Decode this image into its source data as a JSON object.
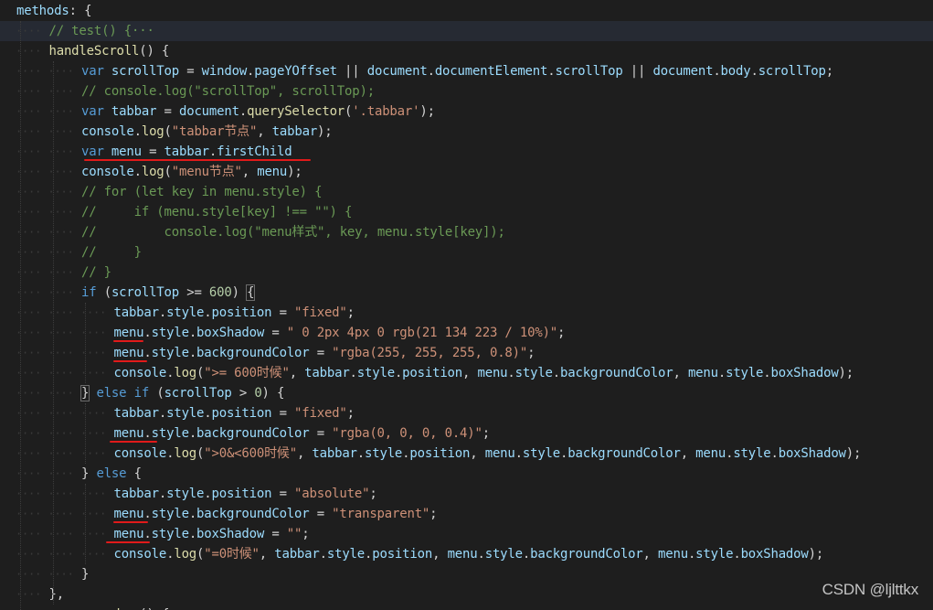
{
  "editor": {
    "language": "javascript",
    "theme_colors": {
      "keyword": "#569cd6",
      "variable": "#9cdcfe",
      "function": "#dcdcaa",
      "string": "#ce9178",
      "number": "#b5cea8",
      "comment": "#6a9955",
      "background": "#1e1e1e"
    },
    "lines": [
      {
        "indent": 0,
        "tokens": [
          [
            "v",
            "methods"
          ],
          [
            "p",
            ": {"
          ]
        ]
      },
      {
        "indent": 1,
        "active": true,
        "tokens": [
          [
            "c",
            "// test() {···"
          ]
        ]
      },
      {
        "indent": 1,
        "tokens": [
          [
            "f",
            "handleScroll"
          ],
          [
            "p",
            "() {"
          ]
        ]
      },
      {
        "indent": 2,
        "tokens": [
          [
            "k",
            "var"
          ],
          [
            "p",
            " "
          ],
          [
            "v",
            "scrollTop"
          ],
          [
            "p",
            " = "
          ],
          [
            "v",
            "window"
          ],
          [
            "p",
            "."
          ],
          [
            "v",
            "pageYOffset"
          ],
          [
            "p",
            " || "
          ],
          [
            "v",
            "document"
          ],
          [
            "p",
            "."
          ],
          [
            "v",
            "documentElement"
          ],
          [
            "p",
            "."
          ],
          [
            "v",
            "scrollTop"
          ],
          [
            "p",
            " || "
          ],
          [
            "v",
            "document"
          ],
          [
            "p",
            "."
          ],
          [
            "v",
            "body"
          ],
          [
            "p",
            "."
          ],
          [
            "v",
            "scrollTop"
          ],
          [
            "p",
            ";"
          ]
        ]
      },
      {
        "indent": 2,
        "tokens": [
          [
            "c",
            "// console.log(\"scrollTop\", scrollTop);"
          ]
        ]
      },
      {
        "indent": 2,
        "tokens": [
          [
            "k",
            "var"
          ],
          [
            "p",
            " "
          ],
          [
            "v",
            "tabbar"
          ],
          [
            "p",
            " = "
          ],
          [
            "v",
            "document"
          ],
          [
            "p",
            "."
          ],
          [
            "f",
            "querySelector"
          ],
          [
            "p",
            "("
          ],
          [
            "s",
            "'.tabbar'"
          ],
          [
            "p",
            ");"
          ]
        ]
      },
      {
        "indent": 2,
        "tokens": [
          [
            "v",
            "console"
          ],
          [
            "p",
            "."
          ],
          [
            "f",
            "log"
          ],
          [
            "p",
            "("
          ],
          [
            "s",
            "\"tabbar节点\""
          ],
          [
            "p",
            ", "
          ],
          [
            "v",
            "tabbar"
          ],
          [
            "p",
            ");"
          ]
        ]
      },
      {
        "indent": 2,
        "tokens": [
          [
            "k",
            "var"
          ],
          [
            "p",
            " "
          ],
          [
            "v",
            "menu"
          ],
          [
            "p",
            " = "
          ],
          [
            "v",
            "tabbar"
          ],
          [
            "p",
            "."
          ],
          [
            "v",
            "firstChild"
          ]
        ]
      },
      {
        "indent": 2,
        "tokens": [
          [
            "v",
            "console"
          ],
          [
            "p",
            "."
          ],
          [
            "f",
            "log"
          ],
          [
            "p",
            "("
          ],
          [
            "s",
            "\"menu节点\""
          ],
          [
            "p",
            ", "
          ],
          [
            "v",
            "menu"
          ],
          [
            "p",
            ");"
          ]
        ]
      },
      {
        "indent": 2,
        "tokens": [
          [
            "c",
            "// for (let key in menu.style) {"
          ]
        ]
      },
      {
        "indent": 2,
        "tokens": [
          [
            "c",
            "//     if (menu.style[key] !== \"\") {"
          ]
        ]
      },
      {
        "indent": 2,
        "tokens": [
          [
            "c",
            "//         console.log(\"menu样式\", key, menu.style[key]);"
          ]
        ]
      },
      {
        "indent": 2,
        "tokens": [
          [
            "c",
            "//     }"
          ]
        ]
      },
      {
        "indent": 2,
        "tokens": [
          [
            "c",
            "// }"
          ]
        ]
      },
      {
        "indent": 2,
        "tokens": [
          [
            "k",
            "if"
          ],
          [
            "p",
            " ("
          ],
          [
            "v",
            "scrollTop"
          ],
          [
            "p",
            " >= "
          ],
          [
            "n",
            "600"
          ],
          [
            "p",
            ") "
          ],
          [
            "sel",
            "{"
          ]
        ]
      },
      {
        "indent": 3,
        "tokens": [
          [
            "v",
            "tabbar"
          ],
          [
            "p",
            "."
          ],
          [
            "v",
            "style"
          ],
          [
            "p",
            "."
          ],
          [
            "v",
            "position"
          ],
          [
            "p",
            " = "
          ],
          [
            "s",
            "\"fixed\""
          ],
          [
            "p",
            ";"
          ]
        ]
      },
      {
        "indent": 3,
        "tokens": [
          [
            "v",
            "menu"
          ],
          [
            "p",
            "."
          ],
          [
            "v",
            "style"
          ],
          [
            "p",
            "."
          ],
          [
            "v",
            "boxShadow"
          ],
          [
            "p",
            " = "
          ],
          [
            "s",
            "\" 0 2px 4px 0 rgb(21 134 223 / 10%)\""
          ],
          [
            "p",
            ";"
          ]
        ]
      },
      {
        "indent": 3,
        "tokens": [
          [
            "v",
            "menu"
          ],
          [
            "p",
            "."
          ],
          [
            "v",
            "style"
          ],
          [
            "p",
            "."
          ],
          [
            "v",
            "backgroundColor"
          ],
          [
            "p",
            " = "
          ],
          [
            "s",
            "\"rgba(255, 255, 255, 0.8)\""
          ],
          [
            "p",
            ";"
          ]
        ]
      },
      {
        "indent": 3,
        "tokens": [
          [
            "v",
            "console"
          ],
          [
            "p",
            "."
          ],
          [
            "f",
            "log"
          ],
          [
            "p",
            "("
          ],
          [
            "s",
            "\">= 600时候\""
          ],
          [
            "p",
            ", "
          ],
          [
            "v",
            "tabbar"
          ],
          [
            "p",
            "."
          ],
          [
            "v",
            "style"
          ],
          [
            "p",
            "."
          ],
          [
            "v",
            "position"
          ],
          [
            "p",
            ", "
          ],
          [
            "v",
            "menu"
          ],
          [
            "p",
            "."
          ],
          [
            "v",
            "style"
          ],
          [
            "p",
            "."
          ],
          [
            "v",
            "backgroundColor"
          ],
          [
            "p",
            ", "
          ],
          [
            "v",
            "menu"
          ],
          [
            "p",
            "."
          ],
          [
            "v",
            "style"
          ],
          [
            "p",
            "."
          ],
          [
            "v",
            "boxShadow"
          ],
          [
            "p",
            ");"
          ]
        ]
      },
      {
        "indent": 2,
        "tokens": [
          [
            "sel",
            "}"
          ],
          [
            "p",
            " "
          ],
          [
            "k",
            "else"
          ],
          [
            "p",
            " "
          ],
          [
            "k",
            "if"
          ],
          [
            "p",
            " ("
          ],
          [
            "v",
            "scrollTop"
          ],
          [
            "p",
            " > "
          ],
          [
            "n",
            "0"
          ],
          [
            "p",
            ") {"
          ]
        ]
      },
      {
        "indent": 3,
        "tokens": [
          [
            "v",
            "tabbar"
          ],
          [
            "p",
            "."
          ],
          [
            "v",
            "style"
          ],
          [
            "p",
            "."
          ],
          [
            "v",
            "position"
          ],
          [
            "p",
            " = "
          ],
          [
            "s",
            "\"fixed\""
          ],
          [
            "p",
            ";"
          ]
        ]
      },
      {
        "indent": 3,
        "tokens": [
          [
            "v",
            "menu"
          ],
          [
            "p",
            "."
          ],
          [
            "v",
            "style"
          ],
          [
            "p",
            "."
          ],
          [
            "v",
            "backgroundColor"
          ],
          [
            "p",
            " = "
          ],
          [
            "s",
            "\"rgba(0, 0, 0, 0.4)\""
          ],
          [
            "p",
            ";"
          ]
        ]
      },
      {
        "indent": 3,
        "tokens": [
          [
            "v",
            "console"
          ],
          [
            "p",
            "."
          ],
          [
            "f",
            "log"
          ],
          [
            "p",
            "("
          ],
          [
            "s",
            "\">0&<600时候\""
          ],
          [
            "p",
            ", "
          ],
          [
            "v",
            "tabbar"
          ],
          [
            "p",
            "."
          ],
          [
            "v",
            "style"
          ],
          [
            "p",
            "."
          ],
          [
            "v",
            "position"
          ],
          [
            "p",
            ", "
          ],
          [
            "v",
            "menu"
          ],
          [
            "p",
            "."
          ],
          [
            "v",
            "style"
          ],
          [
            "p",
            "."
          ],
          [
            "v",
            "backgroundColor"
          ],
          [
            "p",
            ", "
          ],
          [
            "v",
            "menu"
          ],
          [
            "p",
            "."
          ],
          [
            "v",
            "style"
          ],
          [
            "p",
            "."
          ],
          [
            "v",
            "boxShadow"
          ],
          [
            "p",
            ");"
          ]
        ]
      },
      {
        "indent": 2,
        "tokens": [
          [
            "p",
            "} "
          ],
          [
            "k",
            "else"
          ],
          [
            "p",
            " {"
          ]
        ]
      },
      {
        "indent": 3,
        "tokens": [
          [
            "v",
            "tabbar"
          ],
          [
            "p",
            "."
          ],
          [
            "v",
            "style"
          ],
          [
            "p",
            "."
          ],
          [
            "v",
            "position"
          ],
          [
            "p",
            " = "
          ],
          [
            "s",
            "\"absolute\""
          ],
          [
            "p",
            ";"
          ]
        ]
      },
      {
        "indent": 3,
        "tokens": [
          [
            "v",
            "menu"
          ],
          [
            "p",
            "."
          ],
          [
            "v",
            "style"
          ],
          [
            "p",
            "."
          ],
          [
            "v",
            "backgroundColor"
          ],
          [
            "p",
            " = "
          ],
          [
            "s",
            "\"transparent\""
          ],
          [
            "p",
            ";"
          ]
        ]
      },
      {
        "indent": 3,
        "tokens": [
          [
            "v",
            "menu"
          ],
          [
            "p",
            "."
          ],
          [
            "v",
            "style"
          ],
          [
            "p",
            "."
          ],
          [
            "v",
            "boxShadow"
          ],
          [
            "p",
            " = "
          ],
          [
            "s",
            "\"\""
          ],
          [
            "p",
            ";"
          ]
        ]
      },
      {
        "indent": 3,
        "tokens": [
          [
            "v",
            "console"
          ],
          [
            "p",
            "."
          ],
          [
            "f",
            "log"
          ],
          [
            "p",
            "("
          ],
          [
            "s",
            "\"=0时候\""
          ],
          [
            "p",
            ", "
          ],
          [
            "v",
            "tabbar"
          ],
          [
            "p",
            "."
          ],
          [
            "v",
            "style"
          ],
          [
            "p",
            "."
          ],
          [
            "v",
            "position"
          ],
          [
            "p",
            ", "
          ],
          [
            "v",
            "menu"
          ],
          [
            "p",
            "."
          ],
          [
            "v",
            "style"
          ],
          [
            "p",
            "."
          ],
          [
            "v",
            "backgroundColor"
          ],
          [
            "p",
            ", "
          ],
          [
            "v",
            "menu"
          ],
          [
            "p",
            "."
          ],
          [
            "v",
            "style"
          ],
          [
            "p",
            "."
          ],
          [
            "v",
            "boxShadow"
          ],
          [
            "p",
            ");"
          ]
        ]
      },
      {
        "indent": 2,
        "tokens": [
          [
            "p",
            "}"
          ]
        ]
      },
      {
        "indent": 1,
        "tokens": [
          [
            "p",
            "},"
          ]
        ]
      },
      {
        "indent": 1,
        "tokens": [
          [
            "p",
            "        "
          ],
          [
            "f",
            "show"
          ],
          [
            "p",
            "() {"
          ]
        ]
      }
    ],
    "annotations": {
      "underlined_lines": [
        7,
        16,
        17,
        21,
        25,
        26
      ],
      "color": "#e11a1a"
    }
  },
  "watermark": {
    "text": "CSDN @ljlttkx"
  }
}
